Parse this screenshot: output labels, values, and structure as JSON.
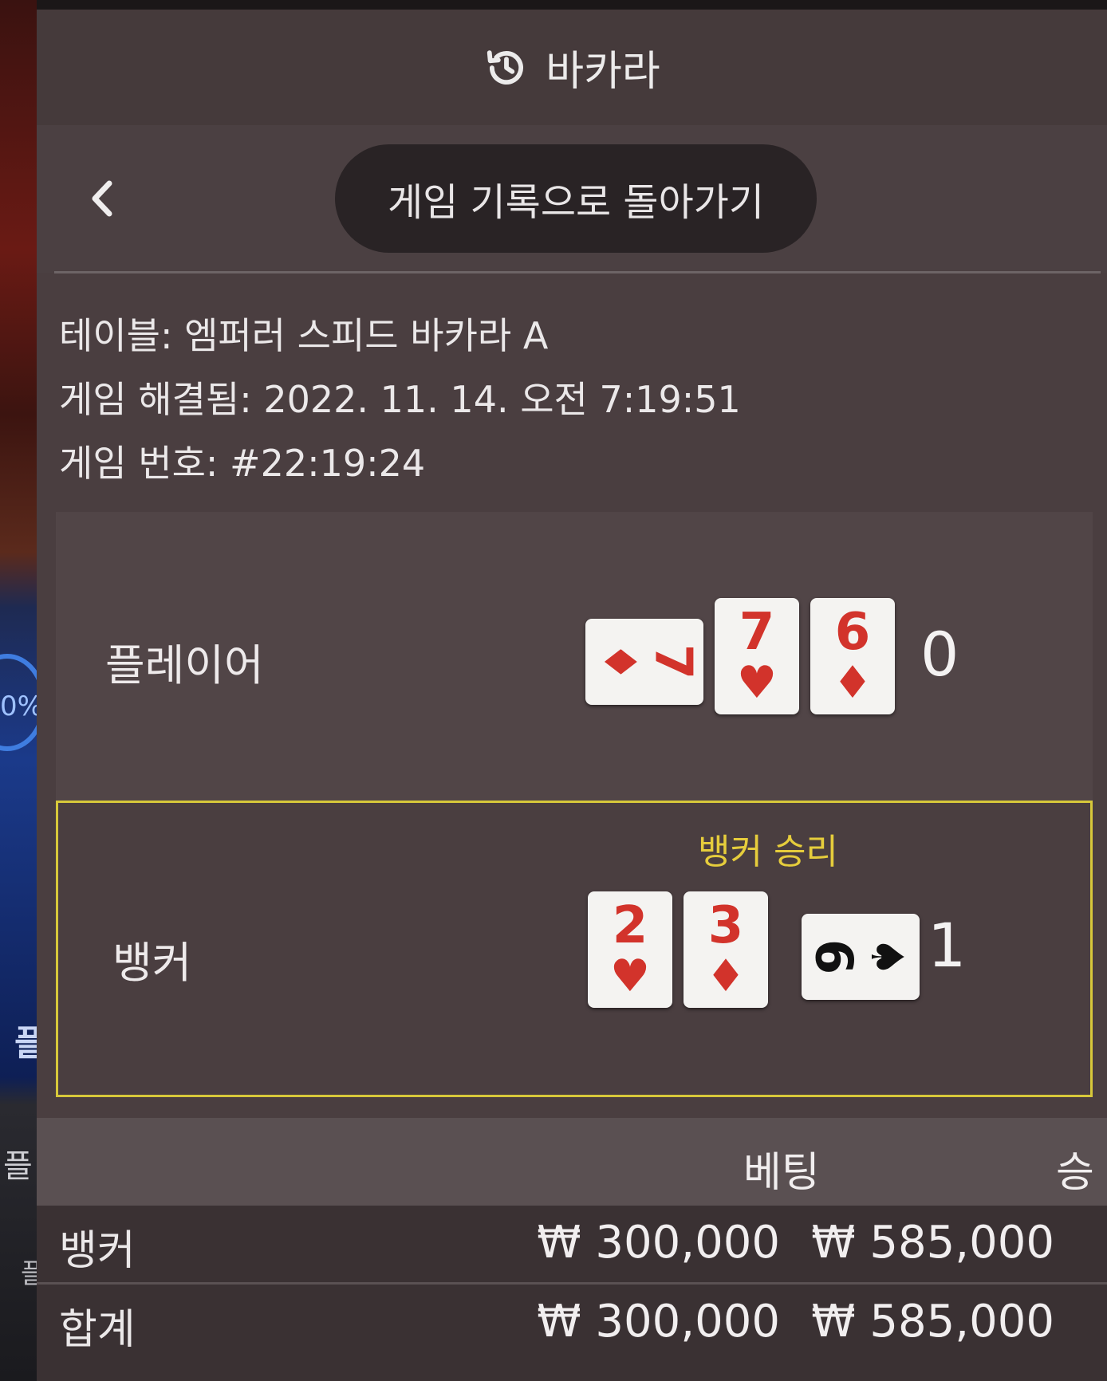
{
  "header": {
    "title": "바카라",
    "icon": "history-icon"
  },
  "nav": {
    "back_icon": "chevron-left-icon",
    "return_label": "게임 기록으로 돌아가기"
  },
  "info": {
    "table": "테이블: 엠퍼러 스피드 바카라 A",
    "resolved": "게임 해결됨: 2022. 11. 14. 오전 7:19:51",
    "game_number": "게임 번호: #22:19:24"
  },
  "player": {
    "label": "플레이어",
    "score": "0",
    "cards": [
      {
        "rank": "7",
        "suit": "♦",
        "color": "#d2332b",
        "orientation": "sideways"
      },
      {
        "rank": "7",
        "suit": "♥",
        "color": "#d2332b",
        "orientation": "upright"
      },
      {
        "rank": "6",
        "suit": "♦",
        "color": "#d2332b",
        "orientation": "upright"
      }
    ]
  },
  "banker": {
    "label": "뱅커",
    "score": "1",
    "win_text": "뱅커 승리",
    "highlight_color": "#d7c83a",
    "cards": [
      {
        "rank": "2",
        "suit": "♥",
        "color": "#d2332b",
        "orientation": "upright"
      },
      {
        "rank": "3",
        "suit": "♦",
        "color": "#d2332b",
        "orientation": "upright"
      },
      {
        "rank": "6",
        "suit": "♠",
        "color": "#111111",
        "orientation": "sideways"
      }
    ]
  },
  "bets": {
    "header_bet": "베팅",
    "header_win": "승",
    "rows": [
      {
        "name": "뱅커",
        "bet": "₩ 300,000",
        "win": "₩ 585,000"
      },
      {
        "name": "합계",
        "bet": "₩ 300,000",
        "win": "₩ 585,000"
      }
    ]
  },
  "background": {
    "percent_text": "0%",
    "glyph1": "플",
    "glyph2": "플",
    "glyph3": "플"
  }
}
